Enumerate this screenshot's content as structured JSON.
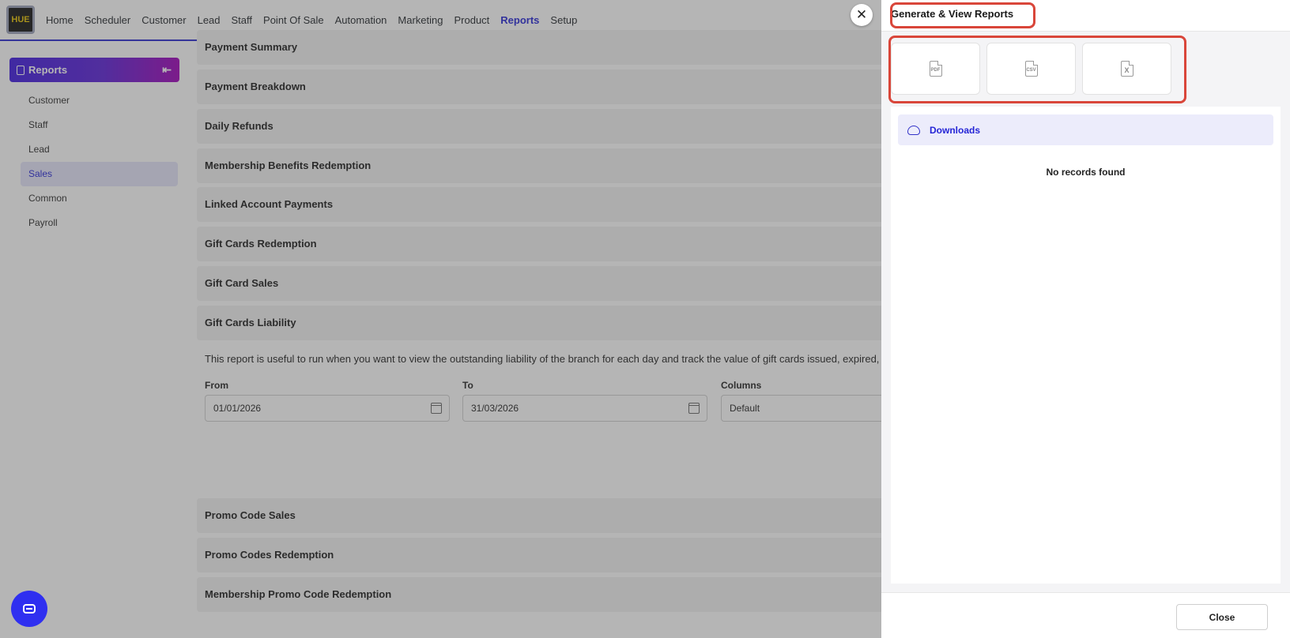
{
  "nav": {
    "logo_text": "HUE",
    "items": [
      "Home",
      "Scheduler",
      "Customer",
      "Lead",
      "Staff",
      "Point Of Sale",
      "Automation",
      "Marketing",
      "Product",
      "Reports",
      "Setup"
    ],
    "active": "Reports"
  },
  "sidebar": {
    "title": "Reports",
    "items": [
      "Customer",
      "Staff",
      "Lead",
      "Sales",
      "Common",
      "Payroll"
    ],
    "active": "Sales"
  },
  "main": {
    "sections": [
      "Payment Summary",
      "Payment Breakdown",
      "Daily Refunds",
      "Membership Benefits Redemption",
      "Linked Account Payments",
      "Gift Cards Redemption",
      "Gift Card Sales",
      "Gift Cards Liability"
    ],
    "description": "This report is useful to run when you want to view the outstanding liability of the branch for each day and track the value of gift cards issued, expired, refunded",
    "from_label": "From",
    "from_value": "01/01/2026",
    "to_label": "To",
    "to_value": "31/03/2026",
    "columns_label": "Columns",
    "columns_value": "Default",
    "sections_after": [
      "Promo Code Sales",
      "Promo Codes Redemption",
      "Membership Promo Code Redemption"
    ]
  },
  "panel": {
    "title": "Generate & View Reports",
    "formats": [
      {
        "label": "PDF",
        "icon": "pdf-file-icon"
      },
      {
        "label": "CSV",
        "icon": "csv-file-icon"
      },
      {
        "label": "X",
        "icon": "excel-file-icon"
      }
    ],
    "downloads_label": "Downloads",
    "empty_text": "No records found",
    "close_label": "Close"
  },
  "colors": {
    "accent": "#2525d6",
    "highlight": "#d9463a"
  }
}
